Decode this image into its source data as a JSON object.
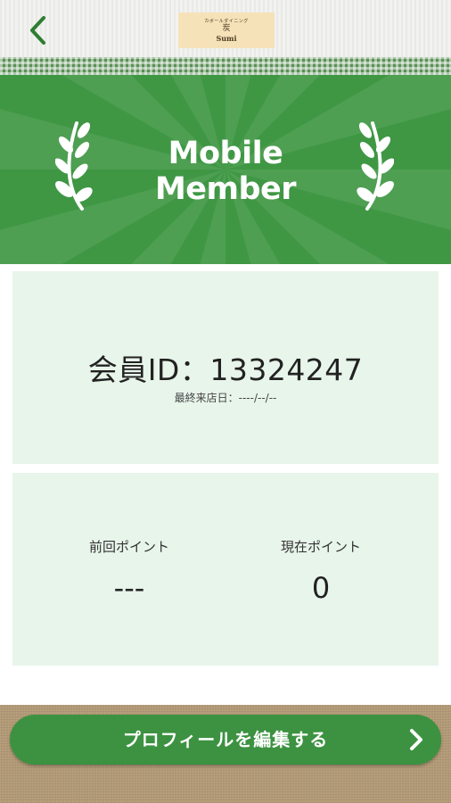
{
  "header": {
    "back_icon": "chevron-left-icon",
    "logo": {
      "line1": "カボールダイニング",
      "line2": "炭",
      "line3": "Sumi"
    }
  },
  "banner": {
    "title_line1": "Mobile",
    "title_line2": "Member",
    "color": "#3f9744"
  },
  "member": {
    "id_label": "会員ID：13324247",
    "last_visit": "最終来店日：----/--/--"
  },
  "points": {
    "previous_label": "前回ポイント",
    "previous_value": "---",
    "current_label": "現在ポイント",
    "current_value": "0"
  },
  "actions": {
    "edit_profile_label": "プロフィールを編集する",
    "edit_profile_icon": "chevron-right-icon"
  },
  "colors": {
    "accent": "#3c9241",
    "panel": "#e8f5ea"
  }
}
